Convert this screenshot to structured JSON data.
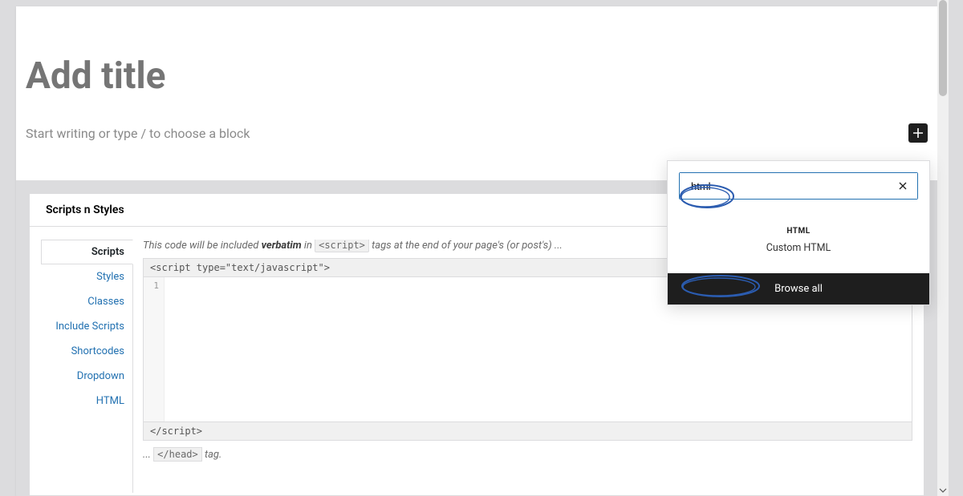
{
  "editor": {
    "title_placeholder": "Add title",
    "content_placeholder": "Start writing or type / to choose a block"
  },
  "inserter": {
    "search_value": "html",
    "result": {
      "icon_label": "HTML",
      "name": "Custom HTML"
    },
    "browse_all": "Browse all"
  },
  "metabox": {
    "title": "Scripts n Styles",
    "tabs": [
      "Scripts",
      "Styles",
      "Classes",
      "Include Scripts",
      "Shortcodes",
      "Dropdown",
      "HTML"
    ],
    "active_tab": "Scripts",
    "desc_prefix": "This code will be included ",
    "desc_bold": "verbatim",
    "desc_mid": " in ",
    "desc_code": "<script>",
    "desc_suffix": " tags at the end of your page's (or post's) ...",
    "editor": {
      "open_tag": "<script type=\"text/javascript\">",
      "line_number": "1",
      "close_tag": "</script>"
    },
    "desc2_prefix": "... ",
    "desc2_code": "</head>",
    "desc2_suffix": " tag."
  }
}
